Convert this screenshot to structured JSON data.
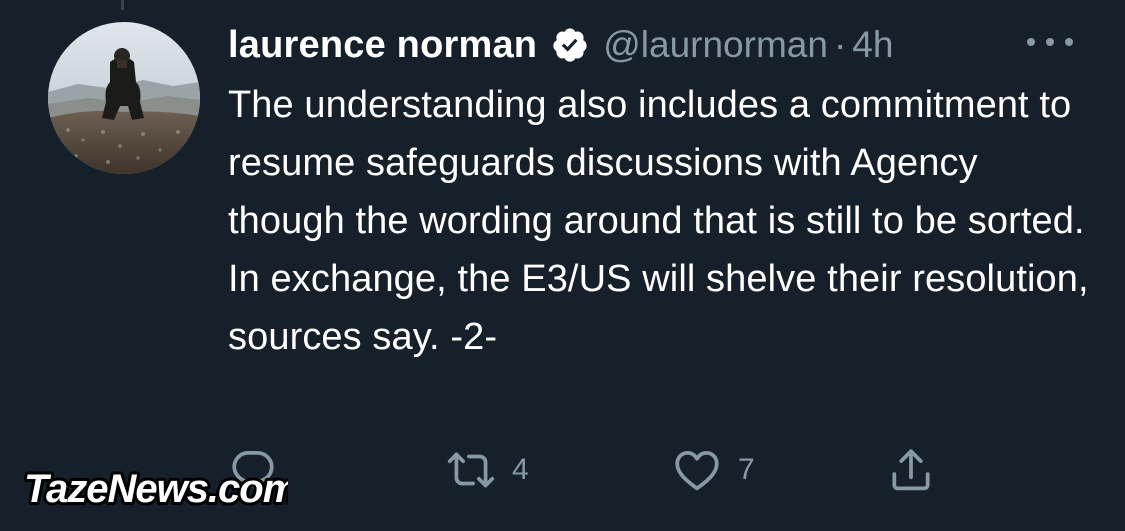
{
  "tweet": {
    "display_name": "laurence norman",
    "handle": "@laurnorman",
    "separator": "·",
    "time": "4h",
    "text": "The understanding also includes a commitment to resume safeguards discussions with Agency though the wording around that is still to be sorted. In exchange, the E3/US will shelve their resolution, sources say. -2-",
    "verified": true
  },
  "actions": {
    "reply": {
      "icon": "reply-icon",
      "count": ""
    },
    "retweet": {
      "icon": "retweet-icon",
      "count": "4"
    },
    "like": {
      "icon": "heart-icon",
      "count": "7"
    },
    "share": {
      "icon": "share-icon"
    }
  },
  "watermark": {
    "text": "TazeNews.com"
  },
  "colors": {
    "background": "#15202b",
    "text": "#ffffff",
    "secondary": "#8899a6",
    "verified_badge": "#ffffff"
  }
}
